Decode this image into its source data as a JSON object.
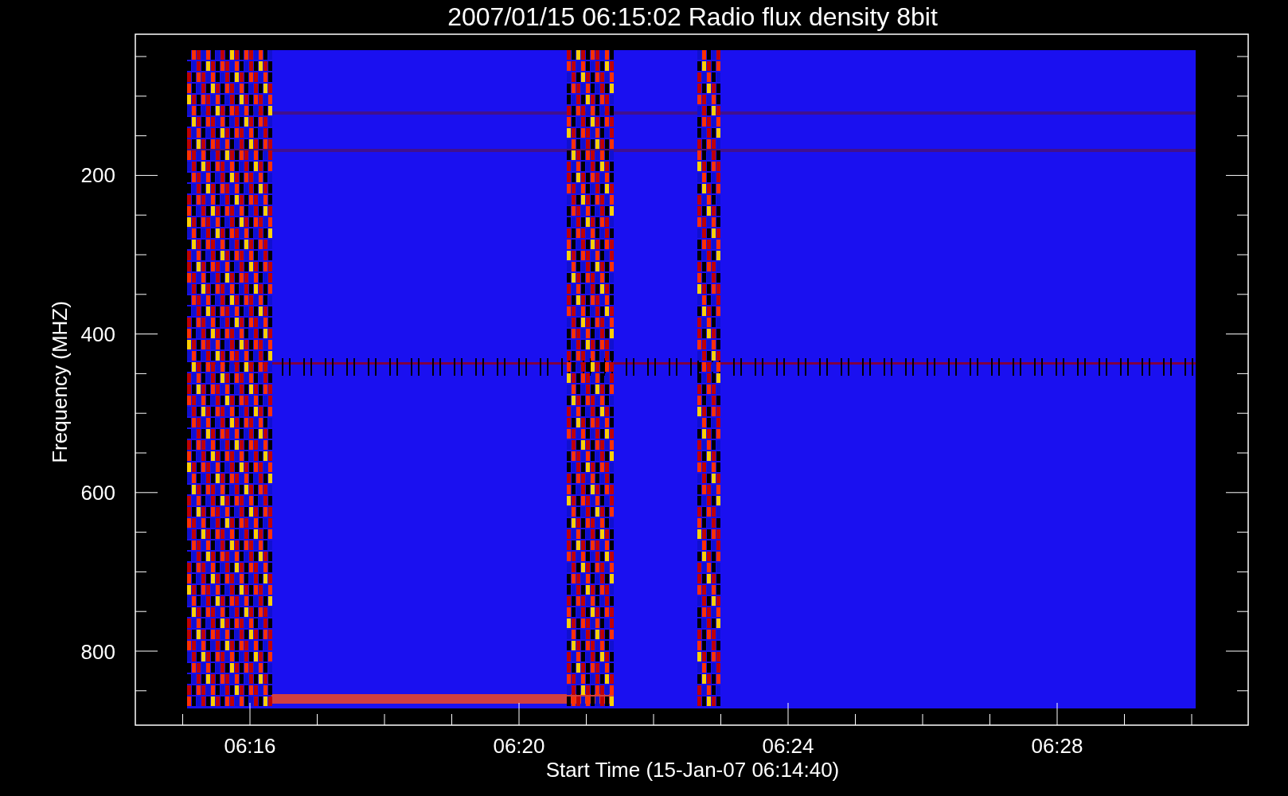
{
  "title": "2007/01/15 06:15:02 Radio flux density 8bit",
  "y_axis": {
    "label": "Frequency (MHZ)",
    "ticks": [
      "200",
      "400",
      "600",
      "800"
    ]
  },
  "x_axis": {
    "label": "Start Time (15-Jan-07 06:14:40)",
    "ticks": [
      "06:16",
      "06:20",
      "06:24",
      "06:28"
    ]
  }
}
